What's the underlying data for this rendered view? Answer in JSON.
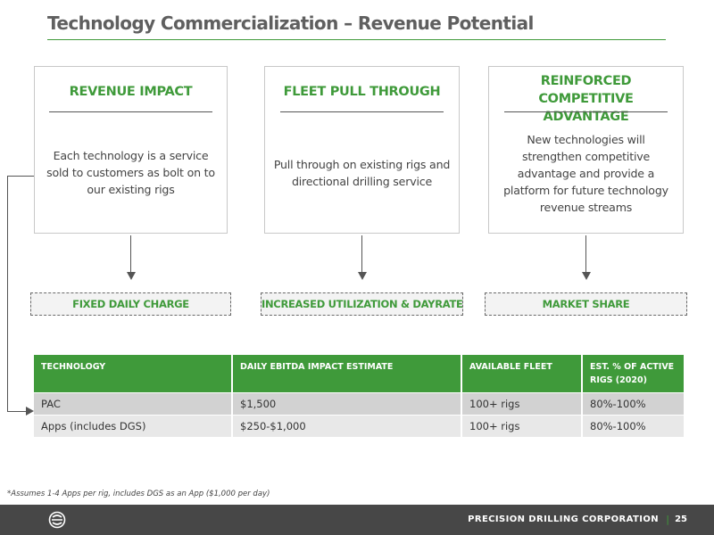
{
  "title": "Technology Commercialization – Revenue Potential",
  "cards": [
    {
      "heading": "REVENUE IMPACT",
      "body": "Each technology is a service sold to customers as bolt on to our existing rigs",
      "outcome": "FIXED DAILY CHARGE"
    },
    {
      "heading": "FLEET PULL THROUGH",
      "body": "Pull through on existing rigs and directional drilling service",
      "outcome": "INCREASED UTILIZATION & DAYRATE"
    },
    {
      "heading": "REINFORCED COMPETITIVE ADVANTAGE",
      "body": "New technologies will strengthen competitive advantage and provide a platform for future technology revenue streams",
      "outcome": "MARKET SHARE"
    }
  ],
  "table": {
    "headers": [
      "TECHNOLOGY",
      "DAILY EBITDA IMPACT ESTIMATE",
      "AVAILABLE FLEET",
      "EST. % OF ACTIVE RIGS (2020)"
    ],
    "rows": [
      [
        "PAC",
        "$1,500",
        "100+ rigs",
        "80%-100%"
      ],
      [
        "Apps (includes DGS)",
        "$250-$1,000",
        "100+ rigs",
        "80%-100%"
      ]
    ]
  },
  "footnote": "*Assumes 1-4 Apps per rig, includes DGS as an App ($1,000 per day)",
  "footer": {
    "company": "PRECISION DRILLING CORPORATION",
    "separator": "|",
    "page": "25",
    "logo_icon": "precision-drilling-logo-icon"
  },
  "colors": {
    "accent_green": "#3f9a3a",
    "footer_bg": "#474747",
    "title_gray": "#5f5f5f"
  }
}
